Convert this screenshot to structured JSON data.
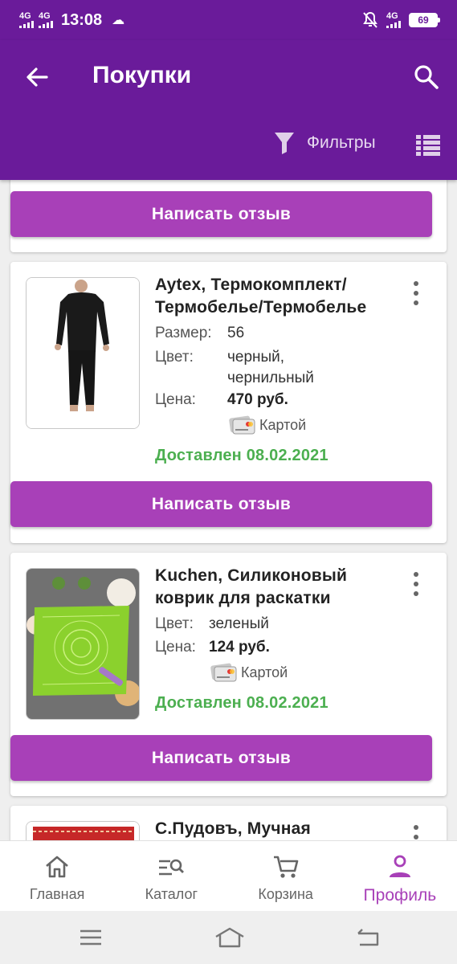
{
  "status_bar": {
    "net1": "4G",
    "net2": "4G",
    "time": "13:08",
    "net3": "4G",
    "battery": "69"
  },
  "header": {
    "title": "Покупки",
    "filter_label": "Фильтры"
  },
  "top_card": {
    "review_label": "Написать отзыв"
  },
  "orders": [
    {
      "name": "Aytex, Термокомплект/ Термобелье/Термобелье",
      "size_label": "Размер:",
      "size": "56",
      "color_label": "Цвет:",
      "color": "черный, чернильный",
      "price_label": "Цена:",
      "price": "470 руб.",
      "payment": "Картой",
      "status": "Доставлен 08.02.2021",
      "review_label": "Написать отзыв"
    },
    {
      "name": "Kuchen, Силиконовый коврик для раскатки",
      "color_label": "Цвет:",
      "color": "зеленый",
      "price_label": "Цена:",
      "price": "124 руб.",
      "payment": "Картой",
      "status": "Доставлен 08.02.2021",
      "review_label": "Написать отзыв"
    },
    {
      "name": "С.Пудовъ, Мучная"
    }
  ],
  "bottom_nav": [
    {
      "label": "Главная",
      "icon": "home-icon"
    },
    {
      "label": "Каталог",
      "icon": "catalog-icon"
    },
    {
      "label": "Корзина",
      "icon": "cart-icon"
    },
    {
      "label": "Профиль",
      "icon": "profile-icon",
      "active": true
    }
  ],
  "colors": {
    "primary": "#6a1b9a",
    "accent": "#a840b8",
    "success": "#4caf50"
  }
}
